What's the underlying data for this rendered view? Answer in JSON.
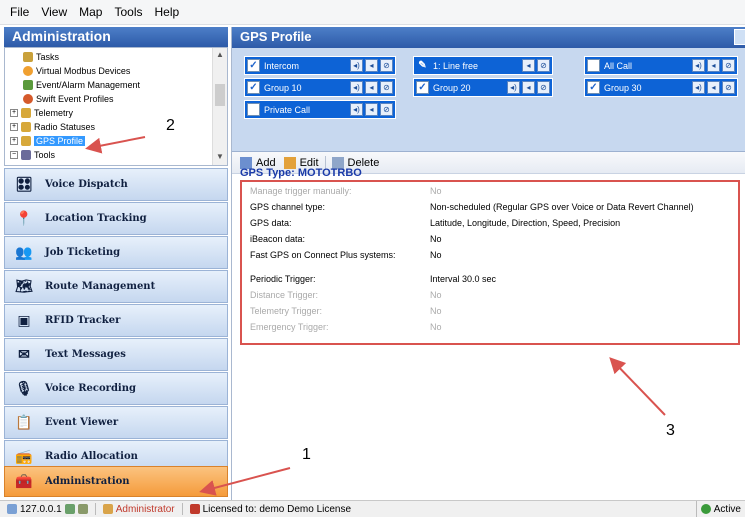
{
  "menu": [
    "File",
    "View",
    "Map",
    "Tools",
    "Help"
  ],
  "left_panel": {
    "title": "Administration",
    "tree": [
      {
        "label": "Tasks",
        "icon": "tasks-icon"
      },
      {
        "label": "Virtual Modbus Devices",
        "icon": "modbus-icon"
      },
      {
        "label": "Event/Alarm Management",
        "icon": "alarm-icon"
      },
      {
        "label": "Swift Event Profiles",
        "icon": "profile-icon"
      },
      {
        "label": "Telemetry",
        "icon": "telemetry-icon"
      },
      {
        "label": "Radio Statuses",
        "icon": "radio-status-icon"
      },
      {
        "label": "GPS Profile",
        "icon": "gps-icon"
      },
      {
        "label": "Tools",
        "icon": "tools-icon"
      }
    ],
    "nav": [
      {
        "label": "Voice Dispatch",
        "icon": "voice-dispatch-icon"
      },
      {
        "label": "Location Tracking",
        "icon": "location-icon"
      },
      {
        "label": "Job Ticketing",
        "icon": "job-ticket-icon"
      },
      {
        "label": "Route Management",
        "icon": "route-icon"
      },
      {
        "label": "RFID Tracker",
        "icon": "rfid-icon"
      },
      {
        "label": "Text Messages",
        "icon": "envelope-icon"
      },
      {
        "label": "Voice Recording",
        "icon": "microphone-icon"
      },
      {
        "label": "Event Viewer",
        "icon": "event-viewer-icon"
      },
      {
        "label": "Radio Allocation",
        "icon": "radio-allocation-icon"
      },
      {
        "label": "Administration",
        "icon": "administration-icon"
      }
    ]
  },
  "right_panel": {
    "title": "GPS Profile",
    "channels": [
      {
        "label": "Intercom",
        "checked": true,
        "selected": true
      },
      {
        "label": "1: Line free",
        "checked": false,
        "selected": true
      },
      {
        "label": "All Call",
        "checked": false,
        "selected": true
      },
      {
        "label": "Group 10",
        "checked": true,
        "selected": true
      },
      {
        "label": "Group 20",
        "checked": true,
        "selected": true
      },
      {
        "label": "Group 30",
        "checked": true,
        "selected": true
      },
      {
        "label": "Private Call",
        "checked": false,
        "selected": true
      }
    ],
    "toolbar": {
      "add": "Add",
      "edit": "Edit",
      "delete": "Delete"
    },
    "gps_type": "GPS Type: MOTOTRBO",
    "properties": [
      {
        "label": "Manage trigger manually:",
        "value": "No",
        "dim": true
      },
      {
        "label": "GPS channel type:",
        "value": "Non-scheduled (Regular GPS over Voice or Data Revert Channel)",
        "dim": false
      },
      {
        "label": "GPS data:",
        "value": "Latitude, Longitude, Direction, Speed, Precision",
        "dim": false
      },
      {
        "label": "iBeacon data:",
        "value": "No",
        "dim": false
      },
      {
        "label": "Fast GPS on Connect Plus systems:",
        "value": "No",
        "dim": false
      },
      {
        "label": "Periodic Trigger:",
        "value": "Interval 30.0 sec",
        "dim": false
      },
      {
        "label": "Distance Trigger:",
        "value": "No",
        "dim": true
      },
      {
        "label": "Telemetry Trigger:",
        "value": "No",
        "dim": true
      },
      {
        "label": "Emergency Trigger:",
        "value": "No",
        "dim": true
      }
    ]
  },
  "annotations": [
    "1",
    "2",
    "3"
  ],
  "status_bar": {
    "ip": "127.0.0.1",
    "user": "Administrator",
    "license": "Licensed to: demo Demo License",
    "state": "Active"
  },
  "colors": {
    "header": "#2d5aa8",
    "annotation_red": "#d9534f",
    "active_nav": "#f59b3b",
    "channel_blue": "#0d63d6"
  }
}
